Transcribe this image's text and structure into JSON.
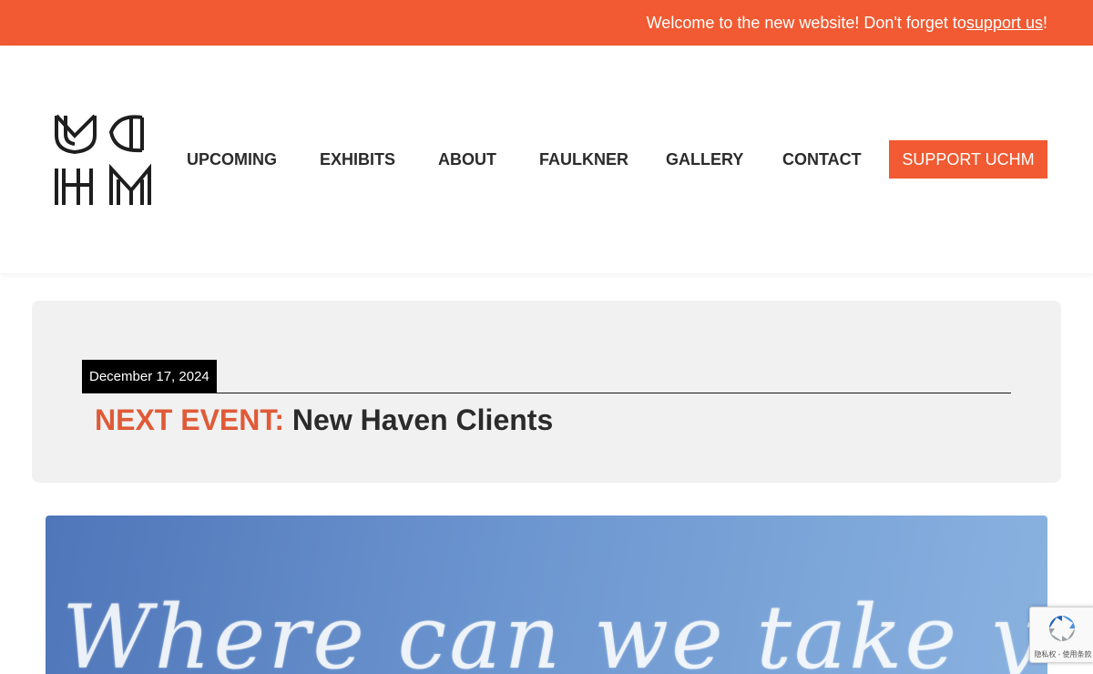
{
  "topbar": {
    "message": "Welcome to the new website! Don't forget to ",
    "link_text": "support us",
    "suffix": "!"
  },
  "logo": {
    "name": "UCHM logo"
  },
  "nav": {
    "items": [
      {
        "label": "UPCOMING"
      },
      {
        "label": "EXHIBITS"
      },
      {
        "label": "ABOUT"
      },
      {
        "label": "FAULKNER"
      },
      {
        "label": "GALLERY"
      },
      {
        "label": "CONTACT"
      }
    ],
    "cta_label": "SUPPORT UCHM"
  },
  "event": {
    "date": "December 17, 2024",
    "label": "NEXT EVENT:",
    "name": "New Haven Clients"
  },
  "hero": {
    "text": "Where can we take you?"
  },
  "recaptcha": {
    "footer": "隐私权 - 使用条款"
  },
  "colors": {
    "accent": "#f15a32",
    "event_label": "#e05a37",
    "text": "#2b2b2b",
    "card_bg": "#f1f1f1"
  }
}
